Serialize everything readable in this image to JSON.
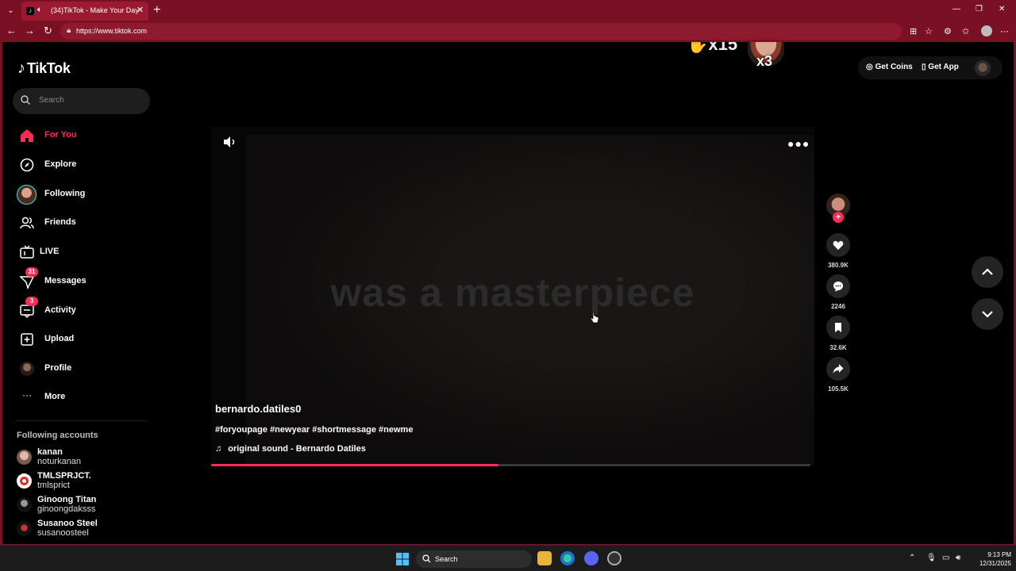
{
  "browser": {
    "tab_title": "(34)TikTok - Make Your Day",
    "tab_close": "✕",
    "new_tab": "+",
    "url": "https://www.tiktok.com"
  },
  "sidebar": {
    "logo": "TikTok",
    "search_placeholder": "Search",
    "nav": [
      {
        "label": "For You",
        "active": true
      },
      {
        "label": "Explore"
      },
      {
        "label": "Following"
      },
      {
        "label": "Friends"
      },
      {
        "label": "LIVE"
      },
      {
        "label": "Messages",
        "badge": "31"
      },
      {
        "label": "Activity",
        "badge": "3"
      },
      {
        "label": "Upload"
      },
      {
        "label": "Profile"
      },
      {
        "label": "More"
      }
    ],
    "following_title": "Following accounts",
    "following": [
      {
        "name": "kanan",
        "handle": "noturkanan"
      },
      {
        "name": "TMLSPRJCT.",
        "handle": "tmlsprict"
      },
      {
        "name": "Ginoong Titan",
        "handle": "ginoongdaksss"
      },
      {
        "name": "Susanoo Steel",
        "handle": "susanoosteel"
      }
    ]
  },
  "header": {
    "get_coins": "Get Coins",
    "get_app": "Get App",
    "sticker1": "x15",
    "sticker2": "x3"
  },
  "video": {
    "caption": "was a masterpiece",
    "author": "bernardo.datiles0",
    "description": "#foryoupage #newyear #shortmessage #newme",
    "sound": "original sound - Bernardo Datiles",
    "progress": 0.48
  },
  "actions": {
    "likes": "380.9K",
    "comments": "2246",
    "saves": "32.6K",
    "shares": "105.5K"
  },
  "taskbar": {
    "search": "Search",
    "time": "9:13 PM",
    "date": "12/31/2025"
  },
  "colors": {
    "accent": "#fe2c55",
    "browser_frame": "#7a1024"
  }
}
